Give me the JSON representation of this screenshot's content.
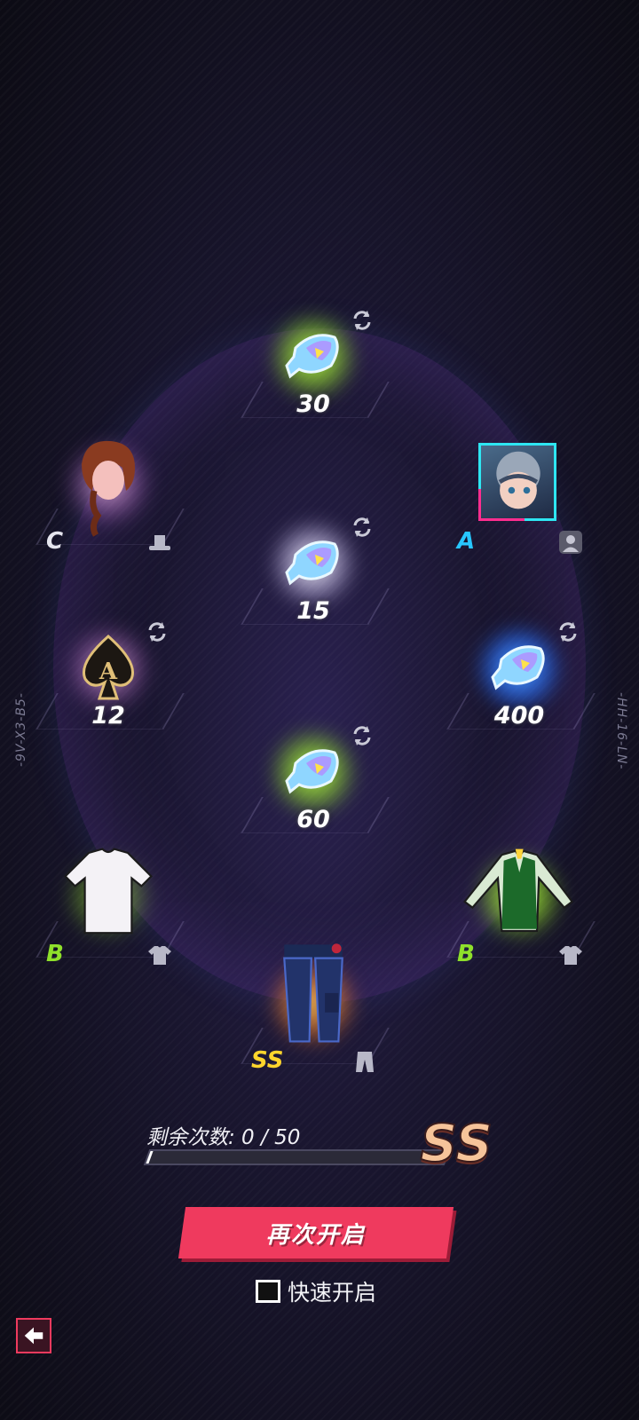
{
  "side_codes": {
    "left": "-9V-X3-B5-",
    "right": "-HH-16-LN-"
  },
  "slots": {
    "fish_top": {
      "qty": "30",
      "glow": "lime",
      "refresh": true
    },
    "hair": {
      "grade": "C",
      "type": "hat-icon",
      "glow": "pink"
    },
    "avatar": {
      "grade": "A",
      "type": "portrait-icon"
    },
    "fish_center": {
      "qty": "15",
      "glow": "white",
      "refresh": true
    },
    "spade_card": {
      "qty": "12",
      "glow": "pink",
      "refresh": true
    },
    "fish_right": {
      "qty": "400",
      "glow": "blue",
      "refresh": true
    },
    "fish_lower": {
      "qty": "60",
      "glow": "lime",
      "refresh": true
    },
    "shirt": {
      "grade": "B",
      "type": "shirt-icon",
      "glow": "lime"
    },
    "jacket": {
      "grade": "B",
      "type": "shirt-icon",
      "glow": "lime"
    },
    "pants": {
      "grade": "SS",
      "type": "pants-icon",
      "glow": "orange"
    }
  },
  "progress": {
    "label": "剩余次数: 0 / 50",
    "current": 0,
    "max": 50,
    "grade": "SS"
  },
  "buttons": {
    "again": "再次开启",
    "quick": "快速开启"
  },
  "colors": {
    "accent": "#ef3a5e",
    "grade_A": "#27c6ff",
    "grade_B": "#8fe02b",
    "grade_SS": "#ffd52c"
  }
}
